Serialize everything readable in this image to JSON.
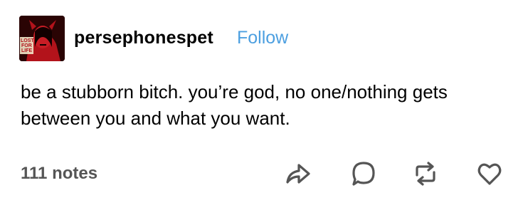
{
  "post": {
    "username": "persephonespet",
    "follow_label": "Follow",
    "text": "be a stubborn bitch. you’re god, no one/nothing gets between you and what you want.",
    "notes": "111 notes"
  },
  "avatar": {
    "badge_lines": [
      "LOST",
      "FOR",
      "LIFE"
    ]
  },
  "icons": {
    "share": "share-arrow-icon",
    "reply": "speech-bubble-icon",
    "reblog": "reblog-icon",
    "like": "heart-icon"
  },
  "colors": {
    "follow": "#4c9fe0",
    "notes": "#555555",
    "icon": "#555555"
  }
}
